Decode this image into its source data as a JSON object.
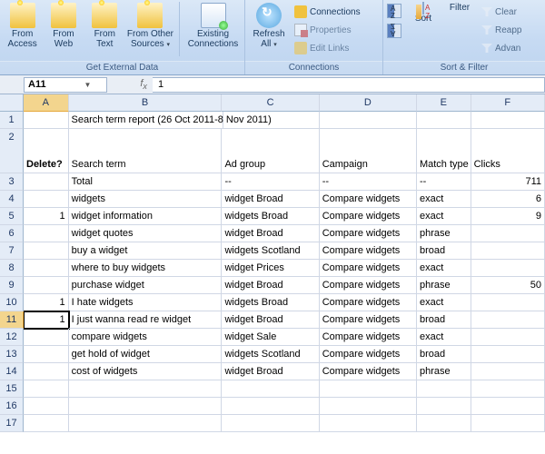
{
  "ribbon": {
    "groups": {
      "getdata": {
        "access": "From Access",
        "web": "From Web",
        "text": "From Text",
        "other": "From Other Sources",
        "existing": "Existing Connections",
        "label": "Get External Data"
      },
      "connections": {
        "refresh": "Refresh All",
        "conn": "Connections",
        "prop": "Properties",
        "edit": "Edit Links",
        "label": "Connections"
      },
      "sortfilter": {
        "sort": "Sort",
        "filter": "Filter",
        "clear": "Clear",
        "reapply": "Reapp",
        "advanced": "Advan",
        "label": "Sort & Filter"
      }
    }
  },
  "namebox": "A11",
  "formula": "1",
  "columns": [
    "A",
    "B",
    "C",
    "D",
    "E",
    "F"
  ],
  "row_headers": [
    "1",
    "2",
    "3",
    "4",
    "5",
    "6",
    "7",
    "8",
    "9",
    "10",
    "11",
    "12",
    "13",
    "14",
    "15",
    "16",
    "17"
  ],
  "active_cell": "A11",
  "cells": {
    "B1": "Search term report (26 Oct 2011-8 Nov 2011)",
    "A2": "Delete?",
    "B2": "Search term",
    "C2": "Ad group",
    "D2": "Campaign",
    "E2": "Match type",
    "F2": "Clicks",
    "B3": "Total",
    "C3": "--",
    "D3": "--",
    "E3": "--",
    "F3": "711",
    "B4": "widgets",
    "C4": "widget Broad",
    "D4": "Compare widgets",
    "E4": "exact",
    "F4": "6",
    "A5": "1",
    "B5": "widget information",
    "C5": "widgets Broad",
    "D5": "Compare widgets",
    "E5": "exact",
    "F5": "9",
    "B6": "widget quotes",
    "C6": "widget Broad",
    "D6": "Compare widgets",
    "E6": "phrase",
    "B7": "buy a widget",
    "C7": "widgets Scotland",
    "D7": "Compare widgets",
    "E7": "broad",
    "B8": "where to buy widgets",
    "C8": "widget Prices",
    "D8": "Compare widgets",
    "E8": "exact",
    "B9": "purchase widget",
    "C9": "widget Broad",
    "D9": "Compare widgets",
    "E9": "phrase",
    "F9": "50",
    "A10": "1",
    "B10": "I hate widgets",
    "C10": "widgets Broad",
    "D10": "Compare widgets",
    "E10": "exact",
    "A11": "1",
    "B11": "I just wanna read re widget",
    "C11": "widget Broad",
    "D11": "Compare widgets",
    "E11": "broad",
    "B12": "compare widgets",
    "C12": "widget Sale",
    "D12": "Compare widgets",
    "E12": "exact",
    "B13": "get hold of widget",
    "C13": "widgets Scotland",
    "D13": "Compare widgets",
    "E13": "broad",
    "B14": "cost of widgets",
    "C14": "widget Broad",
    "D14": "Compare widgets",
    "E14": "phrase"
  }
}
